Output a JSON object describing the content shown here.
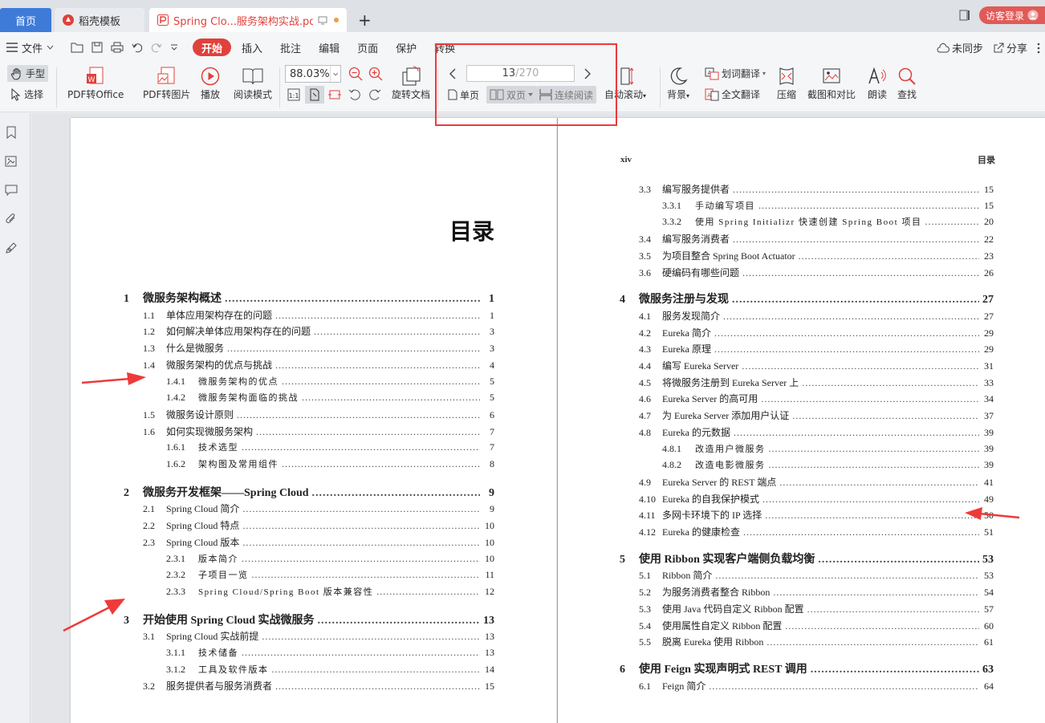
{
  "tabs": {
    "home": "首页",
    "templates": "稻壳模板",
    "document": "Spring Clo...服务架构实战.pdf",
    "guest_login": "访客登录"
  },
  "menu": {
    "file": "文件",
    "items": [
      "开始",
      "插入",
      "批注",
      "编辑",
      "页面",
      "保护",
      "转换"
    ],
    "unsync": "未同步",
    "share": "分享"
  },
  "toolbar": {
    "hand": "手型",
    "select": "选择",
    "pdf_to_office": "PDF转Office",
    "pdf_to_image": "PDF转图片",
    "play": "播放",
    "read_mode": "阅读模式",
    "zoom": "88.03%",
    "rotate_doc": "旋转文档",
    "page_current": "13",
    "page_total": "/270",
    "single_page": "单页",
    "double_page": "双页",
    "continuous": "连续阅读",
    "auto_scroll": "自动滚动",
    "background": "背景",
    "word_translate": "划词翻译",
    "full_translate": "全文翻译",
    "compress": "压缩",
    "screenshot_compare": "截图和对比",
    "read_aloud": "朗读",
    "find": "查找"
  },
  "left_page": {
    "title": "目录",
    "entries": [
      {
        "num": "1",
        "title": "微服务架构概述",
        "page": "1",
        "level": "ch"
      },
      {
        "num": "1.1",
        "title": "单体应用架构存在的问题",
        "page": "1",
        "level": "sec"
      },
      {
        "num": "1.2",
        "title": "如何解决单体应用架构存在的问题",
        "page": "3",
        "level": "sec"
      },
      {
        "num": "1.3",
        "title": "什么是微服务",
        "page": "3",
        "level": "sec"
      },
      {
        "num": "1.4",
        "title": "微服务架构的优点与挑战",
        "page": "4",
        "level": "sec"
      },
      {
        "num": "1.4.1",
        "title": "微服务架构的优点",
        "page": "5",
        "level": "sub"
      },
      {
        "num": "1.4.2",
        "title": "微服务架构面临的挑战",
        "page": "5",
        "level": "sub"
      },
      {
        "num": "1.5",
        "title": "微服务设计原则",
        "page": "6",
        "level": "sec"
      },
      {
        "num": "1.6",
        "title": "如何实现微服务架构",
        "page": "7",
        "level": "sec"
      },
      {
        "num": "1.6.1",
        "title": "技术选型",
        "page": "7",
        "level": "sub"
      },
      {
        "num": "1.6.2",
        "title": "架构图及常用组件",
        "page": "8",
        "level": "sub"
      },
      {
        "num": "2",
        "title": "微服务开发框架——Spring Cloud",
        "page": "9",
        "level": "ch"
      },
      {
        "num": "2.1",
        "title": "Spring Cloud 简介",
        "page": "9",
        "level": "sec"
      },
      {
        "num": "2.2",
        "title": "Spring Cloud 特点",
        "page": "10",
        "level": "sec"
      },
      {
        "num": "2.3",
        "title": "Spring Cloud 版本",
        "page": "10",
        "level": "sec"
      },
      {
        "num": "2.3.1",
        "title": "版本简介",
        "page": "10",
        "level": "sub"
      },
      {
        "num": "2.3.2",
        "title": "子项目一览",
        "page": "11",
        "level": "sub"
      },
      {
        "num": "2.3.3",
        "title": "Spring Cloud/Spring Boot 版本兼容性",
        "page": "12",
        "level": "sub"
      },
      {
        "num": "3",
        "title": "开始使用 Spring Cloud 实战微服务",
        "page": "13",
        "level": "ch"
      },
      {
        "num": "3.1",
        "title": "Spring Cloud 实战前提",
        "page": "13",
        "level": "sec"
      },
      {
        "num": "3.1.1",
        "title": "技术储备",
        "page": "13",
        "level": "sub"
      },
      {
        "num": "3.1.2",
        "title": "工具及软件版本",
        "page": "14",
        "level": "sub"
      },
      {
        "num": "3.2",
        "title": "服务提供者与服务消费者",
        "page": "15",
        "level": "sec"
      }
    ]
  },
  "right_page": {
    "header_left": "xiv",
    "header_right": "目录",
    "entries": [
      {
        "num": "3.3",
        "title": "编写服务提供者",
        "page": "15",
        "level": "sec"
      },
      {
        "num": "3.3.1",
        "title": "手动编写项目",
        "page": "15",
        "level": "sub"
      },
      {
        "num": "3.3.2",
        "title": "使用 Spring Initializr 快速创建 Spring Boot 项目",
        "page": "20",
        "level": "sub"
      },
      {
        "num": "3.4",
        "title": "编写服务消费者",
        "page": "22",
        "level": "sec"
      },
      {
        "num": "3.5",
        "title": "为项目整合 Spring Boot Actuator",
        "page": "23",
        "level": "sec"
      },
      {
        "num": "3.6",
        "title": "硬编码有哪些问题",
        "page": "26",
        "level": "sec"
      },
      {
        "num": "4",
        "title": "微服务注册与发现",
        "page": "27",
        "level": "ch"
      },
      {
        "num": "4.1",
        "title": "服务发现简介",
        "page": "27",
        "level": "sec"
      },
      {
        "num": "4.2",
        "title": "Eureka 简介",
        "page": "29",
        "level": "sec"
      },
      {
        "num": "4.3",
        "title": "Eureka 原理",
        "page": "29",
        "level": "sec"
      },
      {
        "num": "4.4",
        "title": "编写 Eureka Server",
        "page": "31",
        "level": "sec"
      },
      {
        "num": "4.5",
        "title": "将微服务注册到 Eureka Server 上",
        "page": "33",
        "level": "sec"
      },
      {
        "num": "4.6",
        "title": "Eureka Server 的高可用",
        "page": "34",
        "level": "sec"
      },
      {
        "num": "4.7",
        "title": "为 Eureka Server 添加用户认证",
        "page": "37",
        "level": "sec"
      },
      {
        "num": "4.8",
        "title": "Eureka 的元数据",
        "page": "39",
        "level": "sec"
      },
      {
        "num": "4.8.1",
        "title": "改造用户微服务",
        "page": "39",
        "level": "sub"
      },
      {
        "num": "4.8.2",
        "title": "改造电影微服务",
        "page": "39",
        "level": "sub"
      },
      {
        "num": "4.9",
        "title": "Eureka Server 的 REST 端点",
        "page": "41",
        "level": "sec"
      },
      {
        "num": "4.10",
        "title": "Eureka 的自我保护模式",
        "page": "49",
        "level": "sec"
      },
      {
        "num": "4.11",
        "title": "多网卡环境下的 IP 选择",
        "page": "50",
        "level": "sec"
      },
      {
        "num": "4.12",
        "title": "Eureka 的健康检查",
        "page": "51",
        "level": "sec"
      },
      {
        "num": "5",
        "title": "使用 Ribbon 实现客户端侧负载均衡",
        "page": "53",
        "level": "ch"
      },
      {
        "num": "5.1",
        "title": "Ribbon 简介",
        "page": "53",
        "level": "sec"
      },
      {
        "num": "5.2",
        "title": "为服务消费者整合 Ribbon",
        "page": "54",
        "level": "sec"
      },
      {
        "num": "5.3",
        "title": "使用 Java 代码自定义 Ribbon 配置",
        "page": "57",
        "level": "sec"
      },
      {
        "num": "5.4",
        "title": "使用属性自定义 Ribbon 配置",
        "page": "60",
        "level": "sec"
      },
      {
        "num": "5.5",
        "title": "脱离 Eureka 使用 Ribbon",
        "page": "61",
        "level": "sec"
      },
      {
        "num": "6",
        "title": "使用 Feign 实现声明式 REST 调用",
        "page": "63",
        "level": "ch"
      },
      {
        "num": "6.1",
        "title": "Feign 简介",
        "page": "64",
        "level": "sec"
      }
    ]
  },
  "colors": {
    "accent": "#e0413b",
    "home_tab": "#3e7bd9",
    "annotation": "#ee3a3a"
  }
}
